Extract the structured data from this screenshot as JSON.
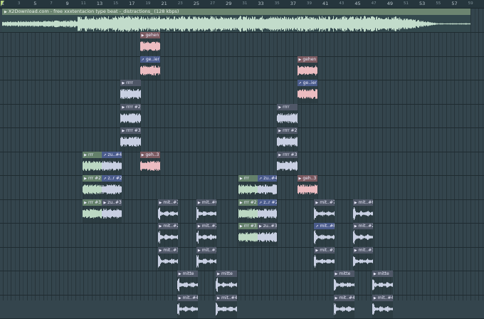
{
  "ruler": {
    "bars": [
      "1",
      "3",
      "5",
      "7",
      "9",
      "11",
      "13",
      "15",
      "17",
      "19",
      "21",
      "23",
      "25",
      "27",
      "29",
      "31",
      "33",
      "35",
      "37",
      "39",
      "41",
      "43",
      "45",
      "47",
      "49",
      "51",
      "53",
      "55",
      "57",
      "59"
    ]
  },
  "master_clip": {
    "title": "X2Download.com - free xxxtentacion type beat -_distractions_ (128 kbps)",
    "start_bar": 1,
    "length_bars": 58
  },
  "colors": {
    "green": "#64806a",
    "pink": "#7b5a60",
    "slate": "#4f5767",
    "auto": "#4b5c8c"
  },
  "clips": [
    {
      "label": "gehen",
      "track": 1,
      "start": 18,
      "len": 2.5,
      "color": "pink"
    },
    {
      "label": "ge..ier",
      "track": 2,
      "start": 18,
      "len": 2.5,
      "color": "auto"
    },
    {
      "label": "gehen",
      "track": 2,
      "start": 37.5,
      "len": 2.5,
      "color": "pink"
    },
    {
      "label": "rrrr",
      "track": 3,
      "start": 15.6,
      "len": 2.5,
      "color": "slate"
    },
    {
      "label": "ge..ier",
      "track": 3,
      "start": 37.5,
      "len": 2.5,
      "color": "auto"
    },
    {
      "label": "rrrr #2",
      "track": 4,
      "start": 15.6,
      "len": 2.5,
      "color": "slate"
    },
    {
      "label": "rrrr",
      "track": 4,
      "start": 35,
      "len": 2.5,
      "color": "slate"
    },
    {
      "label": "rrrr #3",
      "track": 5,
      "start": 15.6,
      "len": 2.5,
      "color": "slate"
    },
    {
      "label": "rrrr #2",
      "track": 5,
      "start": 35,
      "len": 2.5,
      "color": "slate"
    },
    {
      "label": "rrr",
      "track": 6,
      "start": 10.9,
      "len": 2.4,
      "color": "green"
    },
    {
      "label": "zu..#4",
      "track": 6,
      "start": 13.3,
      "len": 2.4,
      "color": "auto"
    },
    {
      "label": "geh..3",
      "track": 6,
      "start": 18,
      "len": 2.5,
      "color": "pink"
    },
    {
      "label": "rrrr #3",
      "track": 6,
      "start": 35,
      "len": 2.5,
      "color": "slate"
    },
    {
      "label": "rrr #2",
      "track": 7,
      "start": 10.9,
      "len": 2.4,
      "color": "green"
    },
    {
      "label": "z..r #2",
      "track": 7,
      "start": 13.3,
      "len": 2.4,
      "color": "auto"
    },
    {
      "label": "rrr",
      "track": 7,
      "start": 30.2,
      "len": 2.4,
      "color": "green"
    },
    {
      "label": "zu..#4",
      "track": 7,
      "start": 32.6,
      "len": 2.4,
      "color": "auto"
    },
    {
      "label": "geh..3",
      "track": 7,
      "start": 37.5,
      "len": 2.5,
      "color": "pink"
    },
    {
      "label": "rrr #3",
      "track": 8,
      "start": 10.9,
      "len": 2.4,
      "color": "green"
    },
    {
      "label": "zu..#3",
      "track": 8,
      "start": 13.3,
      "len": 2.4,
      "color": "slate"
    },
    {
      "label": "mit..#7",
      "track": 8,
      "start": 20.2,
      "len": 2.5,
      "color": "slate"
    },
    {
      "label": "mit..#6",
      "track": 8,
      "start": 25,
      "len": 2.5,
      "color": "slate"
    },
    {
      "label": "rrr #2",
      "track": 8,
      "start": 30.2,
      "len": 2.4,
      "color": "green"
    },
    {
      "label": "z..r #2",
      "track": 8,
      "start": 32.6,
      "len": 2.4,
      "color": "auto"
    },
    {
      "label": "mit..#7",
      "track": 8,
      "start": 39.6,
      "len": 2.5,
      "color": "slate"
    },
    {
      "label": "mit..#6",
      "track": 8,
      "start": 44.4,
      "len": 2.5,
      "color": "slate"
    },
    {
      "label": "mit..#2",
      "track": 9,
      "start": 20.2,
      "len": 2.5,
      "color": "slate"
    },
    {
      "label": "mit..#2",
      "track": 9,
      "start": 25,
      "len": 2.5,
      "color": "slate"
    },
    {
      "label": "rrr #3",
      "track": 9,
      "start": 30.2,
      "len": 2.4,
      "color": "green"
    },
    {
      "label": "zu..#3",
      "track": 9,
      "start": 32.6,
      "len": 2.4,
      "color": "slate"
    },
    {
      "label": "mit..#8",
      "track": 9,
      "start": 39.6,
      "len": 2.5,
      "color": "auto"
    },
    {
      "label": "mit..#2",
      "track": 9,
      "start": 44.4,
      "len": 2.5,
      "color": "slate"
    },
    {
      "label": "mit..#3",
      "track": 10,
      "start": 20.2,
      "len": 2.5,
      "color": "slate"
    },
    {
      "label": "mit..#3",
      "track": 10,
      "start": 25,
      "len": 2.5,
      "color": "slate"
    },
    {
      "label": "mit..#3",
      "track": 10,
      "start": 39.6,
      "len": 2.5,
      "color": "slate"
    },
    {
      "label": "mit..#3",
      "track": 10,
      "start": 44.4,
      "len": 2.5,
      "color": "slate"
    },
    {
      "label": "mitte",
      "track": 11,
      "start": 22.6,
      "len": 2.6,
      "color": "slate"
    },
    {
      "label": "mitte",
      "track": 11,
      "start": 27.4,
      "len": 2.6,
      "color": "slate"
    },
    {
      "label": "mitte",
      "track": 11,
      "start": 42,
      "len": 2.6,
      "color": "slate"
    },
    {
      "label": "mitte",
      "track": 11,
      "start": 46.8,
      "len": 2.6,
      "color": "slate"
    },
    {
      "label": "mit..#4",
      "track": 12,
      "start": 22.6,
      "len": 2.6,
      "color": "slate"
    },
    {
      "label": "mit..#4",
      "track": 12,
      "start": 27.4,
      "len": 2.6,
      "color": "slate"
    },
    {
      "label": "mit..#4",
      "track": 12,
      "start": 42,
      "len": 2.6,
      "color": "slate"
    },
    {
      "label": "mit..#4",
      "track": 12,
      "start": 46.8,
      "len": 2.6,
      "color": "slate"
    }
  ]
}
